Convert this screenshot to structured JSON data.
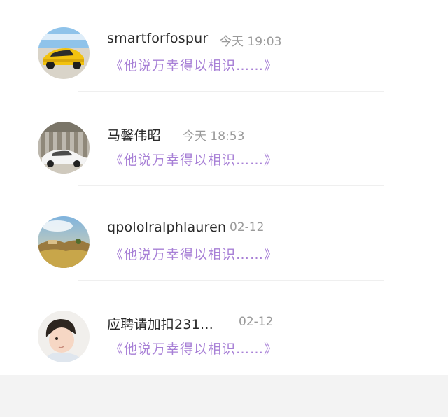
{
  "chats": [
    {
      "name": "smartforfospur",
      "time": "今天 19:03",
      "message": "《他说万幸得以相识……》",
      "avatar_icon": "yellow-sports-car-photo"
    },
    {
      "name": "马馨伟昭",
      "time": "今天 18:53",
      "message": "《他说万幸得以相识……》",
      "avatar_icon": "white-car-photo"
    },
    {
      "name": "qpololralphlauren",
      "time": "02-12",
      "message": "《他说万幸得以相识……》",
      "avatar_icon": "landscape-photo"
    },
    {
      "name": "应聘请加扣231…",
      "time": "02-12",
      "message": "《他说万幸得以相识……》",
      "avatar_icon": "child-photo"
    }
  ],
  "colors": {
    "message": "#a77fd6",
    "name": "#2a2a2a",
    "time": "#9a9a9a",
    "footer": "#f3f3f3"
  }
}
